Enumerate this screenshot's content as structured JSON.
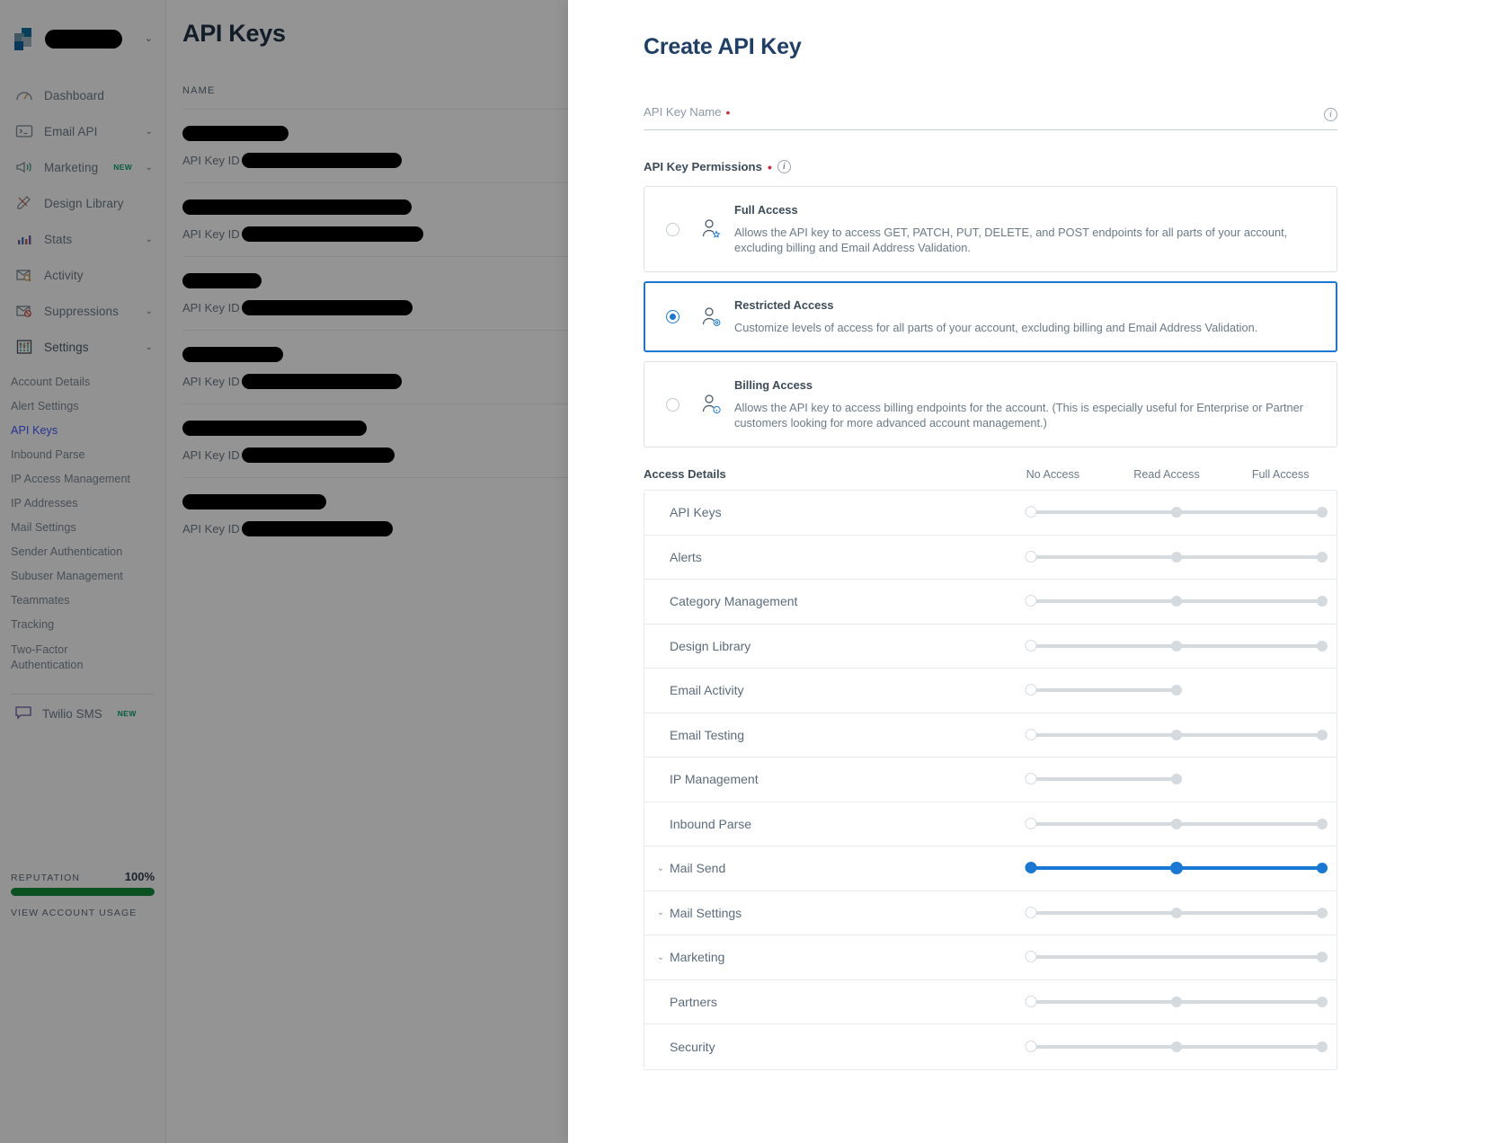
{
  "sidebar": {
    "brand": {
      "caret": "⌄"
    },
    "nav": [
      {
        "label": "Dashboard",
        "icon": "gauge-icon",
        "chevron": false
      },
      {
        "label": "Email API",
        "icon": "terminal-icon",
        "chevron": true
      },
      {
        "label": "Marketing",
        "icon": "megaphone-icon",
        "chevron": true,
        "badge": "NEW"
      },
      {
        "label": "Design Library",
        "icon": "pencil-ruler-icon",
        "chevron": false
      },
      {
        "label": "Stats",
        "icon": "bar-chart-icon",
        "chevron": true
      },
      {
        "label": "Activity",
        "icon": "envelope-search-icon",
        "chevron": false
      },
      {
        "label": "Suppressions",
        "icon": "envelope-block-icon",
        "chevron": true
      },
      {
        "label": "Settings",
        "icon": "sliders-icon",
        "chevron": true
      }
    ],
    "settings_sub": [
      {
        "label": "Account Details",
        "selected": false
      },
      {
        "label": "Alert Settings",
        "selected": false
      },
      {
        "label": "API Keys",
        "selected": true
      },
      {
        "label": "Inbound Parse",
        "selected": false
      },
      {
        "label": "IP Access Management",
        "selected": false
      },
      {
        "label": "IP Addresses",
        "selected": false
      },
      {
        "label": "Mail Settings",
        "selected": false
      },
      {
        "label": "Sender Authentication",
        "selected": false
      },
      {
        "label": "Subuser Management",
        "selected": false
      },
      {
        "label": "Teammates",
        "selected": false
      },
      {
        "label": "Tracking",
        "selected": false
      },
      {
        "label": "Two-Factor Authentication",
        "selected": false
      }
    ],
    "twilio": {
      "label": "Twilio SMS",
      "badge": "NEW",
      "icon": "chat-bubble-icon"
    },
    "reputation": {
      "label": "REPUTATION",
      "value": "100%",
      "percent": 100
    },
    "account_usage_link": "VIEW ACCOUNT USAGE"
  },
  "background_page": {
    "title": "API Keys",
    "column_header": "NAME",
    "rows": [
      {
        "name_width": 118,
        "id_label": "API Key ID",
        "id_width": 178
      },
      {
        "name_width": 255,
        "id_label": "API Key ID",
        "id_width": 202
      },
      {
        "name_width": 88,
        "id_label": "API Key ID",
        "id_width": 190
      },
      {
        "name_width": 112,
        "id_label": "API Key ID",
        "id_width": 178
      },
      {
        "name_width": 205,
        "id_label": "API Key ID",
        "id_width": 170
      },
      {
        "name_width": 160,
        "id_label": "API Key ID",
        "id_width": 168
      }
    ]
  },
  "drawer": {
    "title": "Create API Key",
    "name_field": {
      "label": "API Key Name",
      "required_marker": "•",
      "value": "",
      "placeholder": "",
      "info_icon": "info-icon"
    },
    "permissions_label": "API Key Permissions",
    "permissions_required_marker": "•",
    "permissions_info_icon": "info-icon",
    "options": [
      {
        "title": "Full Access",
        "description": "Allows the API key to access GET, PATCH, PUT, DELETE, and POST endpoints for all parts of your account, excluding billing and Email Address Validation.",
        "selected": false,
        "icon": "user-star-icon"
      },
      {
        "title": "Restricted Access",
        "description": "Customize levels of access for all parts of your account, excluding billing and Email Address Validation.",
        "selected": true,
        "icon": "user-gear-icon"
      },
      {
        "title": "Billing Access",
        "description": "Allows the API key to access billing endpoints for the account. (This is especially useful for Enterprise or Partner customers looking for more advanced account management.)",
        "selected": false,
        "icon": "user-info-icon"
      }
    ],
    "access_details": {
      "title": "Access Details",
      "columns": [
        "No Access",
        "Read Access",
        "Full Access"
      ],
      "rows": [
        {
          "name": "API Keys",
          "expandable": false,
          "stops": 3,
          "value": 0,
          "active": false
        },
        {
          "name": "Alerts",
          "expandable": false,
          "stops": 3,
          "value": 0,
          "active": false
        },
        {
          "name": "Category Management",
          "expandable": false,
          "stops": 3,
          "value": 0,
          "active": false
        },
        {
          "name": "Design Library",
          "expandable": false,
          "stops": 3,
          "value": 0,
          "active": false
        },
        {
          "name": "Email Activity",
          "expandable": false,
          "stops": 2,
          "value": 0,
          "active": false,
          "half": true
        },
        {
          "name": "Email Testing",
          "expandable": false,
          "stops": 3,
          "value": 0,
          "active": false
        },
        {
          "name": "IP Management",
          "expandable": false,
          "stops": 2,
          "value": 0,
          "active": false,
          "half": true
        },
        {
          "name": "Inbound Parse",
          "expandable": false,
          "stops": 3,
          "value": 0,
          "active": false
        },
        {
          "name": "Mail Send",
          "expandable": true,
          "stops": 3,
          "value": 2,
          "active": true
        },
        {
          "name": "Mail Settings",
          "expandable": true,
          "stops": 3,
          "value": 0,
          "active": false
        },
        {
          "name": "Marketing",
          "expandable": true,
          "stops": 2,
          "value": 0,
          "active": false,
          "endsonly": true
        },
        {
          "name": "Partners",
          "expandable": false,
          "stops": 3,
          "value": 0,
          "active": false
        },
        {
          "name": "Security",
          "expandable": false,
          "stops": 3,
          "value": 0,
          "active": false
        }
      ]
    }
  },
  "colors": {
    "accent": "#1878d4",
    "selected_nav": "#3d5afe",
    "reputation_bar": "#128a3a",
    "required": "#c7303a",
    "title": "#1f3f66"
  }
}
